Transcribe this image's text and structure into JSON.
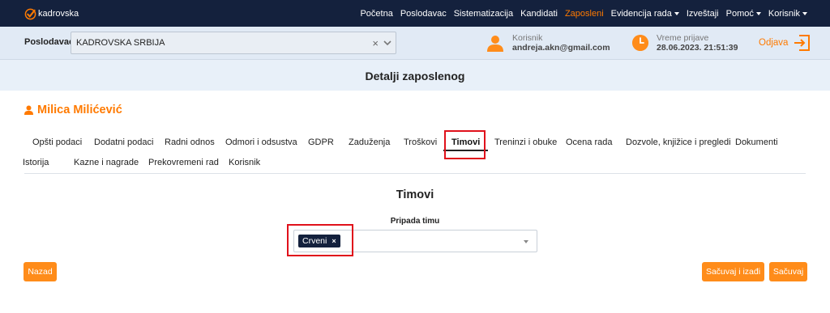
{
  "brand": {
    "name": "kadrovska",
    "accent": "#ff7a00",
    "navy": "#14213d"
  },
  "nav": {
    "items": [
      {
        "label": "Početna",
        "active": false,
        "dropdown": false
      },
      {
        "label": "Poslodavac",
        "active": false,
        "dropdown": false
      },
      {
        "label": "Sistematizacija",
        "active": false,
        "dropdown": false
      },
      {
        "label": "Kandidati",
        "active": false,
        "dropdown": false
      },
      {
        "label": "Zaposleni",
        "active": true,
        "dropdown": false
      },
      {
        "label": "Evidencija rada",
        "active": false,
        "dropdown": true
      },
      {
        "label": "Izveštaji",
        "active": false,
        "dropdown": false
      },
      {
        "label": "Pomoć",
        "active": false,
        "dropdown": true
      },
      {
        "label": "Korisnik",
        "active": false,
        "dropdown": true
      }
    ]
  },
  "employer_bar": {
    "label": "Poslodavac",
    "selected": "KADROVSKA SRBIJA",
    "clear_glyph": "×",
    "user_label": "Korisnik",
    "user_email": "andreja.akn@gmail.com",
    "login_label": "Vreme prijave",
    "login_time": "28.06.2023. 21:51:39",
    "logout_label": "Odjava"
  },
  "page": {
    "title": "Detalji zaposlenog"
  },
  "employee": {
    "name": "Milica Milićević"
  },
  "tabs": {
    "row1": [
      "Opšti podaci",
      "Dodatni podaci",
      "Radni odnos",
      "Odmori i odsustva",
      "GDPR",
      "Zaduženja",
      "Troškovi",
      "Timovi",
      "Treninzi i obuke",
      "Ocena rada",
      "Dozvole, knjižice i pregledi",
      "Dokumenti"
    ],
    "row2": [
      "Istorija",
      "Kazne i nagrade",
      "Prekovremeni rad",
      "Korisnik"
    ],
    "active": "Timovi"
  },
  "section": {
    "title": "Timovi",
    "field_label": "Pripada timu",
    "selected_teams": [
      "Crveni"
    ],
    "chip_remove_glyph": "×"
  },
  "buttons": {
    "back": "Nazad",
    "save_exit": "Sačuvaj i izađi",
    "save": "Sačuvaj"
  }
}
